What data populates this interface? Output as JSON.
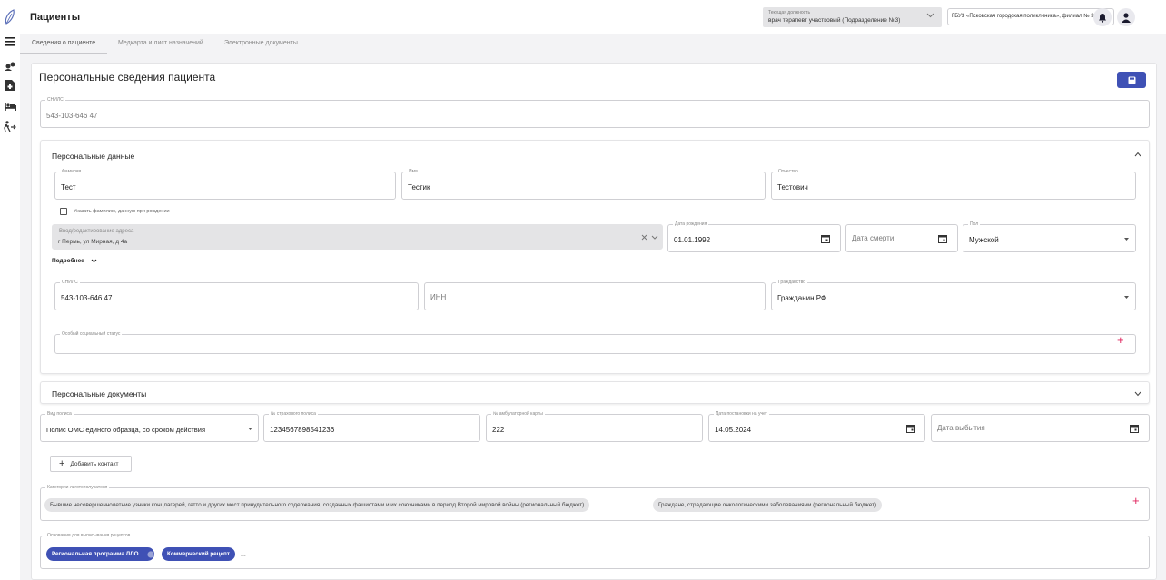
{
  "app": {
    "title": "Пациенты"
  },
  "header": {
    "post_label": "Текущая должность",
    "post_value": "врач терапевт участковый (Подразделение №3)",
    "org_value": "ГБУЗ «Псковская городская поликлиника», филиал № 3"
  },
  "tabs": [
    {
      "label": "Сведения о пациенте",
      "active": true
    },
    {
      "label": "Медкарта и лист назначений",
      "active": false
    },
    {
      "label": "Электронные документы",
      "active": false
    }
  ],
  "main": {
    "title": "Персональные сведения пациента",
    "snils_top": {
      "label": "СНИЛС",
      "value": "543-103-646 47"
    }
  },
  "personal": {
    "title": "Персональные данные",
    "surname": {
      "label": "Фамилия",
      "value": "Тест"
    },
    "name": {
      "label": "Имя",
      "value": "Тестик"
    },
    "patronymic": {
      "label": "Отчество",
      "value": "Тестович"
    },
    "birth_surname_check": "Указать фамилию, данную при рождении",
    "address": {
      "label": "Ввод/редактирование адреса",
      "value": "г Пермь, ул Мирная, д 4а"
    },
    "birth_date": {
      "label": "Дата рождения",
      "value": "01.01.1992"
    },
    "death_date": {
      "placeholder": "Дата смерти"
    },
    "gender": {
      "label": "Пол",
      "value": "Мужской"
    },
    "more_label": "Подробнее",
    "snils": {
      "label": "СНИЛС",
      "value": "543-103-646 47"
    },
    "inn": {
      "placeholder": "ИНН"
    },
    "citizenship": {
      "label": "Гражданство",
      "value": "Гражданин РФ"
    },
    "social_status": {
      "label": "Особый социальный статус"
    }
  },
  "documents": {
    "title": "Персональные документы",
    "policy_type": {
      "label": "Вид полиса",
      "value": "Полис ОМС единого образца, со сроком действия"
    },
    "insurance_no": {
      "label": "№ страхового полиса",
      "value": "1234567898541236"
    },
    "card_no": {
      "label": "№ амбулаторной карты",
      "value": "222"
    },
    "reg_date": {
      "label": "Дата постановки на учет",
      "value": "14.05.2024"
    },
    "leave_date": {
      "placeholder": "Дата выбытия"
    },
    "add_contact": "Добавить контакт"
  },
  "benefits": {
    "label": "Категории льготополучателя",
    "chips": [
      "Бывшие несовершеннолетние узники концлагерей, гетто и других мест принудительного содержания, созданных фашистами и их союзниками в период Второй мировой войны (региональный бюджет)",
      "Граждане, страдающие онкологическими заболеваниями (региональный бюджет)"
    ]
  },
  "prescriptions": {
    "label": "Основания для выписывания рецептов",
    "chips": [
      "Региональная программа ЛЛО",
      "Коммерческий рецепт"
    ],
    "more": "..."
  },
  "colors": {
    "accent": "#3f51b5",
    "plus": "#e0245e"
  }
}
